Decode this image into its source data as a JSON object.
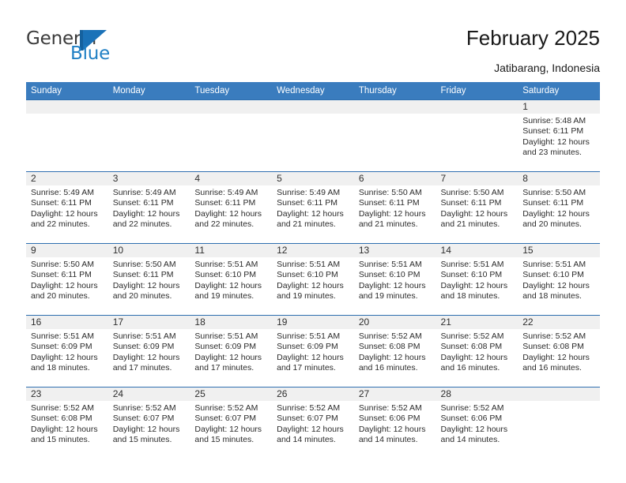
{
  "logo": {
    "word_one": "General",
    "word_two": "Blue",
    "mark": "triangle-logo-mark"
  },
  "header": {
    "title": "February 2025",
    "subtitle": "Jatibarang, Indonesia"
  },
  "calendar": {
    "weekday_headers": [
      "Sunday",
      "Monday",
      "Tuesday",
      "Wednesday",
      "Thursday",
      "Friday",
      "Saturday"
    ],
    "accent_color": "#3a7cbe",
    "row_border_color": "#2f6fb0",
    "daynum_band_color": "#f0f0f0",
    "weeks": [
      [
        {
          "day": "",
          "lines": [],
          "blank": true
        },
        {
          "day": "",
          "lines": [],
          "blank": true
        },
        {
          "day": "",
          "lines": [],
          "blank": true
        },
        {
          "day": "",
          "lines": [],
          "blank": true
        },
        {
          "day": "",
          "lines": [],
          "blank": true
        },
        {
          "day": "",
          "lines": [],
          "blank": true
        },
        {
          "day": "1",
          "lines": [
            "Sunrise: 5:48 AM",
            "Sunset: 6:11 PM",
            "Daylight: 12 hours",
            "and 23 minutes."
          ],
          "blank": false
        }
      ],
      [
        {
          "day": "2",
          "lines": [
            "Sunrise: 5:49 AM",
            "Sunset: 6:11 PM",
            "Daylight: 12 hours",
            "and 22 minutes."
          ],
          "blank": false
        },
        {
          "day": "3",
          "lines": [
            "Sunrise: 5:49 AM",
            "Sunset: 6:11 PM",
            "Daylight: 12 hours",
            "and 22 minutes."
          ],
          "blank": false
        },
        {
          "day": "4",
          "lines": [
            "Sunrise: 5:49 AM",
            "Sunset: 6:11 PM",
            "Daylight: 12 hours",
            "and 22 minutes."
          ],
          "blank": false
        },
        {
          "day": "5",
          "lines": [
            "Sunrise: 5:49 AM",
            "Sunset: 6:11 PM",
            "Daylight: 12 hours",
            "and 21 minutes."
          ],
          "blank": false
        },
        {
          "day": "6",
          "lines": [
            "Sunrise: 5:50 AM",
            "Sunset: 6:11 PM",
            "Daylight: 12 hours",
            "and 21 minutes."
          ],
          "blank": false
        },
        {
          "day": "7",
          "lines": [
            "Sunrise: 5:50 AM",
            "Sunset: 6:11 PM",
            "Daylight: 12 hours",
            "and 21 minutes."
          ],
          "blank": false
        },
        {
          "day": "8",
          "lines": [
            "Sunrise: 5:50 AM",
            "Sunset: 6:11 PM",
            "Daylight: 12 hours",
            "and 20 minutes."
          ],
          "blank": false
        }
      ],
      [
        {
          "day": "9",
          "lines": [
            "Sunrise: 5:50 AM",
            "Sunset: 6:11 PM",
            "Daylight: 12 hours",
            "and 20 minutes."
          ],
          "blank": false
        },
        {
          "day": "10",
          "lines": [
            "Sunrise: 5:50 AM",
            "Sunset: 6:11 PM",
            "Daylight: 12 hours",
            "and 20 minutes."
          ],
          "blank": false
        },
        {
          "day": "11",
          "lines": [
            "Sunrise: 5:51 AM",
            "Sunset: 6:10 PM",
            "Daylight: 12 hours",
            "and 19 minutes."
          ],
          "blank": false
        },
        {
          "day": "12",
          "lines": [
            "Sunrise: 5:51 AM",
            "Sunset: 6:10 PM",
            "Daylight: 12 hours",
            "and 19 minutes."
          ],
          "blank": false
        },
        {
          "day": "13",
          "lines": [
            "Sunrise: 5:51 AM",
            "Sunset: 6:10 PM",
            "Daylight: 12 hours",
            "and 19 minutes."
          ],
          "blank": false
        },
        {
          "day": "14",
          "lines": [
            "Sunrise: 5:51 AM",
            "Sunset: 6:10 PM",
            "Daylight: 12 hours",
            "and 18 minutes."
          ],
          "blank": false
        },
        {
          "day": "15",
          "lines": [
            "Sunrise: 5:51 AM",
            "Sunset: 6:10 PM",
            "Daylight: 12 hours",
            "and 18 minutes."
          ],
          "blank": false
        }
      ],
      [
        {
          "day": "16",
          "lines": [
            "Sunrise: 5:51 AM",
            "Sunset: 6:09 PM",
            "Daylight: 12 hours",
            "and 18 minutes."
          ],
          "blank": false
        },
        {
          "day": "17",
          "lines": [
            "Sunrise: 5:51 AM",
            "Sunset: 6:09 PM",
            "Daylight: 12 hours",
            "and 17 minutes."
          ],
          "blank": false
        },
        {
          "day": "18",
          "lines": [
            "Sunrise: 5:51 AM",
            "Sunset: 6:09 PM",
            "Daylight: 12 hours",
            "and 17 minutes."
          ],
          "blank": false
        },
        {
          "day": "19",
          "lines": [
            "Sunrise: 5:51 AM",
            "Sunset: 6:09 PM",
            "Daylight: 12 hours",
            "and 17 minutes."
          ],
          "blank": false
        },
        {
          "day": "20",
          "lines": [
            "Sunrise: 5:52 AM",
            "Sunset: 6:08 PM",
            "Daylight: 12 hours",
            "and 16 minutes."
          ],
          "blank": false
        },
        {
          "day": "21",
          "lines": [
            "Sunrise: 5:52 AM",
            "Sunset: 6:08 PM",
            "Daylight: 12 hours",
            "and 16 minutes."
          ],
          "blank": false
        },
        {
          "day": "22",
          "lines": [
            "Sunrise: 5:52 AM",
            "Sunset: 6:08 PM",
            "Daylight: 12 hours",
            "and 16 minutes."
          ],
          "blank": false
        }
      ],
      [
        {
          "day": "23",
          "lines": [
            "Sunrise: 5:52 AM",
            "Sunset: 6:08 PM",
            "Daylight: 12 hours",
            "and 15 minutes."
          ],
          "blank": false
        },
        {
          "day": "24",
          "lines": [
            "Sunrise: 5:52 AM",
            "Sunset: 6:07 PM",
            "Daylight: 12 hours",
            "and 15 minutes."
          ],
          "blank": false
        },
        {
          "day": "25",
          "lines": [
            "Sunrise: 5:52 AM",
            "Sunset: 6:07 PM",
            "Daylight: 12 hours",
            "and 15 minutes."
          ],
          "blank": false
        },
        {
          "day": "26",
          "lines": [
            "Sunrise: 5:52 AM",
            "Sunset: 6:07 PM",
            "Daylight: 12 hours",
            "and 14 minutes."
          ],
          "blank": false
        },
        {
          "day": "27",
          "lines": [
            "Sunrise: 5:52 AM",
            "Sunset: 6:06 PM",
            "Daylight: 12 hours",
            "and 14 minutes."
          ],
          "blank": false
        },
        {
          "day": "28",
          "lines": [
            "Sunrise: 5:52 AM",
            "Sunset: 6:06 PM",
            "Daylight: 12 hours",
            "and 14 minutes."
          ],
          "blank": false
        },
        {
          "day": "",
          "lines": [],
          "blank": true
        }
      ]
    ]
  }
}
